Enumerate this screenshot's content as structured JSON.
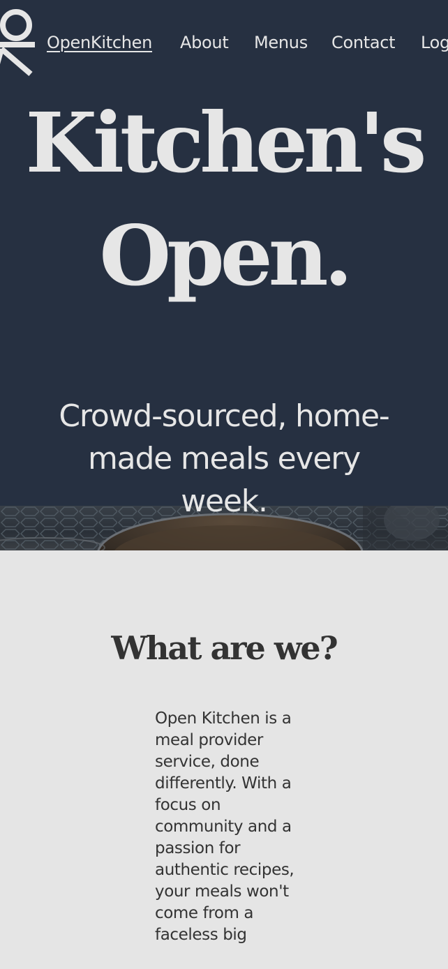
{
  "nav": {
    "logo_icon": "ok-monogram-logo",
    "brand": "OpenKitchen",
    "about": "About",
    "menus": "Menus",
    "contact": "Contact",
    "login": "Log"
  },
  "hero": {
    "title_line1": "Kitchen's",
    "title_line2": "Open.",
    "subtitle": "Crowd-sourced, home-made meals every week."
  },
  "about_section": {
    "title": "What are we?",
    "body": "Open Kitchen is a meal provider service, done differently. With a focus on community and a passion for authentic recipes, your meals won't come from a faceless big"
  },
  "colors": {
    "hero_background": "#263041",
    "hero_text": "#e6e6e6",
    "section_background": "#e5e5e5",
    "section_text": "#333333"
  }
}
